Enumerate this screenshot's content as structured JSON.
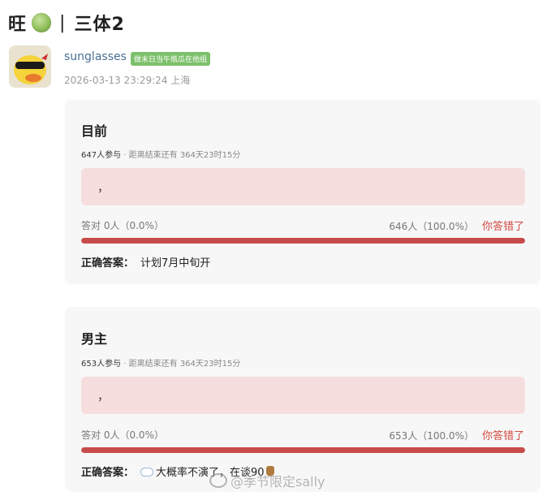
{
  "post": {
    "title_prefix": "旺",
    "title_icon": "melon-icon",
    "title_sep": "|",
    "title_main": "三体2"
  },
  "user": {
    "name": "sunglasses",
    "badge": "做末日当午瓶瓜在他组",
    "datetime": "2026-03-13 23:29:24",
    "location": "上海",
    "avatar_icon": "duck-sunglasses-avatar"
  },
  "polls": [
    {
      "title": "目前",
      "participants": "647人参与",
      "time_left": "距离结束还有 364天23时15分",
      "option_text": "，",
      "correct_label": "答对",
      "correct_stats": "0人（0.0%）",
      "wrong_stats": "646人（100.0%）",
      "wrong_label": "你答错了",
      "wrong_fraction": 1.0,
      "answer_label": "正确答案：",
      "answer_text": "计划7月中旬开"
    },
    {
      "title": "男主",
      "participants": "653人参与",
      "time_left": "距离结束还有 364天23时15分",
      "option_text": "，",
      "correct_label": "答对",
      "correct_stats": "0人（0.0%）",
      "wrong_stats": "653人（100.0%）",
      "wrong_label": "你答错了",
      "wrong_fraction": 1.0,
      "answer_label": "正确答案：",
      "answer_text": "大概率不演了，在谈90"
    }
  ],
  "watermark": "@季节限定sally",
  "colors": {
    "bar": "#c84b4b",
    "option_bg": "#f7dede",
    "wrong_text": "#d24a43",
    "username": "#4a6f94",
    "badge": "#7cc06a"
  }
}
